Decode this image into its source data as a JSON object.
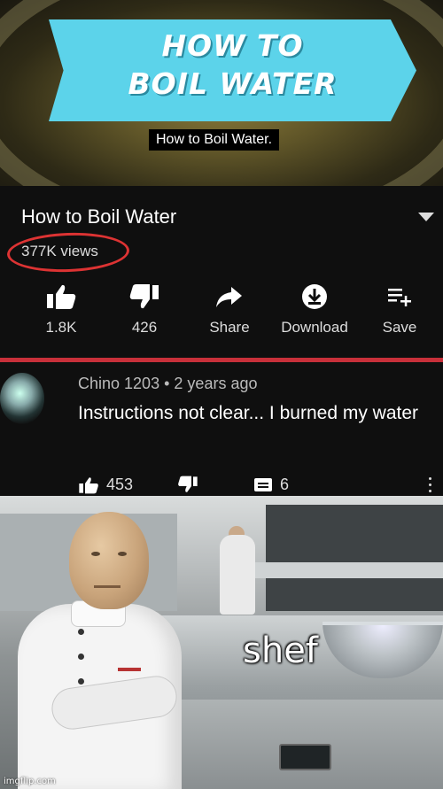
{
  "thumbnail": {
    "banner_line1": "HOW TO",
    "banner_line2": "BOIL WATER",
    "caption": "How to Boil Water.",
    "banner_color": "#5cd3ea"
  },
  "video": {
    "title": "How to Boil Water",
    "views": "377K views",
    "actions": [
      {
        "icon": "thumbs-up-icon",
        "label": "1.8K"
      },
      {
        "icon": "thumbs-down-icon",
        "label": "426"
      },
      {
        "icon": "share-icon",
        "label": "Share"
      },
      {
        "icon": "download-icon",
        "label": "Download"
      },
      {
        "icon": "save-playlist-icon",
        "label": "Save"
      }
    ],
    "highlight_color": "#d33333"
  },
  "comment": {
    "author": "Chino 1203",
    "separator": "•",
    "time": "2 years ago",
    "text": "Instructions not clear... I burned my water",
    "likes": "453",
    "replies": "6"
  },
  "meme": {
    "caption": "shef",
    "watermark": "imgflip.com"
  }
}
